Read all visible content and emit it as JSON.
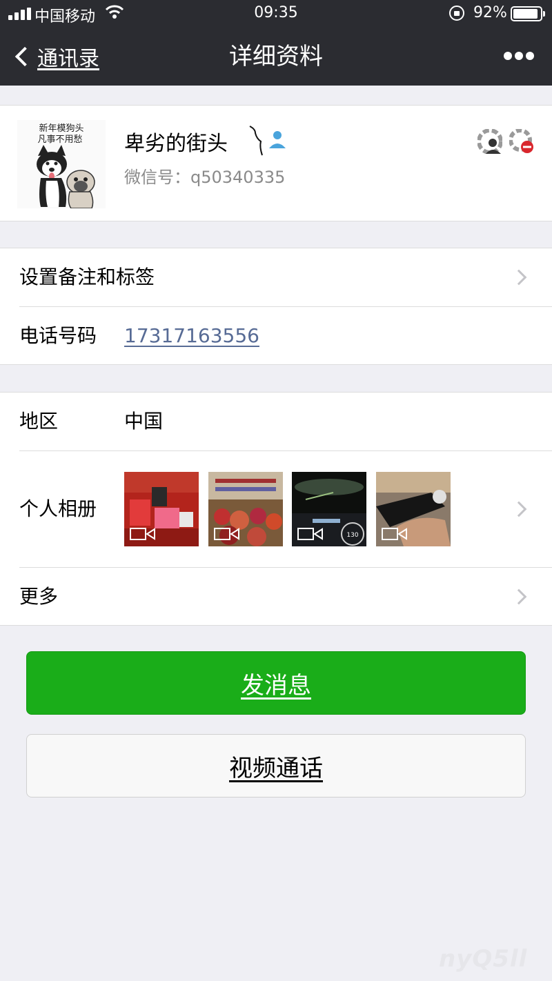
{
  "status_bar": {
    "carrier": "中国移动",
    "time": "09:35",
    "battery": "92%",
    "battery_level": 0.92
  },
  "nav": {
    "back_label": "通讯录",
    "title": "详细资料"
  },
  "profile": {
    "avatar_text_line1": "新年模狗头",
    "avatar_text_line2": "凡事不用愁",
    "name": "卑劣的街头",
    "wechat_id": "微信号：q50340335"
  },
  "rows": {
    "remark": {
      "label": "设置备注和标签"
    },
    "phone": {
      "label": "电话号码",
      "value": "17317163556"
    },
    "region": {
      "label": "地区",
      "value": "中国"
    },
    "album": {
      "label": "个人相册"
    },
    "more": {
      "label": "更多"
    }
  },
  "buttons": {
    "message": "发消息",
    "video_call": "视频通话"
  },
  "watermark": "nyQ5ll",
  "colors": {
    "header_bg": "#2b2c31",
    "background": "#efeff4",
    "primary_green": "#1aad19",
    "link_blue": "#576b95"
  }
}
